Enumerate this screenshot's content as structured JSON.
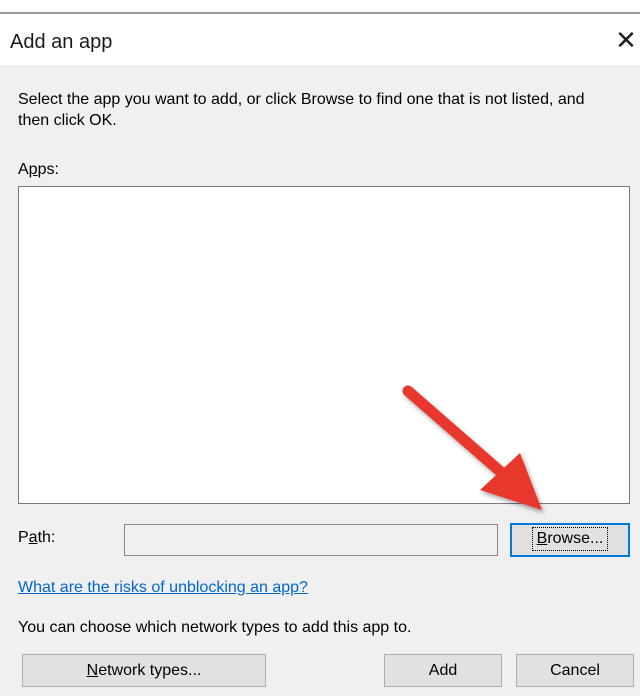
{
  "window": {
    "title": "Add an app",
    "close_glyph": "✕"
  },
  "dialog": {
    "instructions": "Select the app you want to add, or click Browse to find one that is not listed, and then click OK.",
    "apps_label_pre": "A",
    "apps_label_acc": "p",
    "apps_label_post": "ps:",
    "path_label_pre": "P",
    "path_label_acc": "a",
    "path_label_post": "th:",
    "path_value": "",
    "browse_acc": "B",
    "browse_rest": "rowse...",
    "risks_link": "What are the risks of unblocking an app?",
    "network_note": "You can choose which network types to add this app to.",
    "network_acc": "N",
    "network_rest": "etwork types...",
    "add_label": "Add",
    "cancel_label": "Cancel"
  },
  "colors": {
    "arrow": "#e8392e",
    "link": "#0066cc",
    "focus_border": "#0078d7"
  }
}
